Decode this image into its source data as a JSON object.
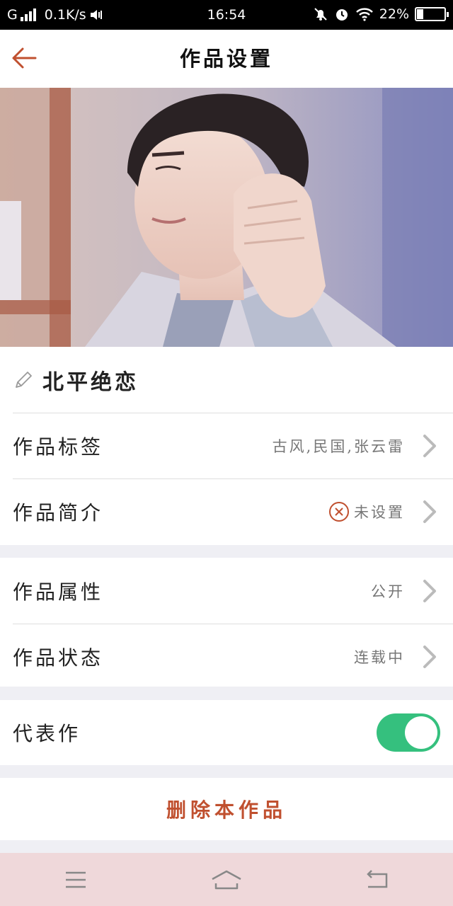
{
  "status_bar": {
    "carrier": "G",
    "speed": "0.1K/s",
    "time": "16:54",
    "battery": "22%"
  },
  "header": {
    "title": "作品设置",
    "back_icon": "arrow-left-icon"
  },
  "work": {
    "name": "北平绝恋"
  },
  "rows": {
    "tags": {
      "label": "作品标签",
      "value": "古风,民国,张云雷"
    },
    "intro": {
      "label": "作品简介",
      "value": "未设置"
    },
    "attribute": {
      "label": "作品属性",
      "value": "公开"
    },
    "status": {
      "label": "作品状态",
      "value": "连载中"
    },
    "representative": {
      "label": "代表作",
      "on": true
    }
  },
  "delete_label": "删除本作品",
  "colors": {
    "accent": "#c0502f",
    "toggle_on": "#35c07e",
    "nav_bg": "#efd8da"
  }
}
